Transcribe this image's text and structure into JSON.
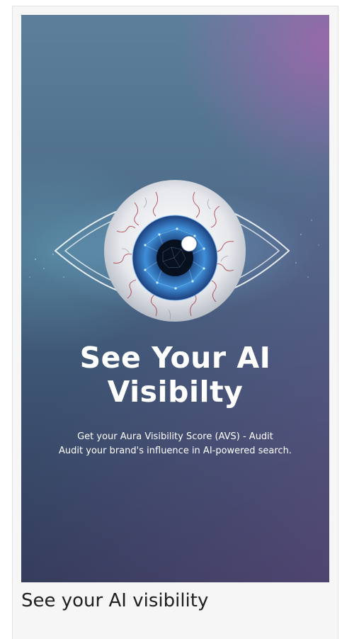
{
  "poster": {
    "headline_line1": "See Your AI",
    "headline_line2": "Visibilty",
    "subtitle_line1": "Get your Aura Visibility Score (AVS) - Audit",
    "subtitle_line2": "Audit your brand's influence in AI-powered search."
  },
  "caption": "See your AI visibility",
  "colors": {
    "background_top": "#5d7f9c",
    "background_bottom": "#2f3a57",
    "accent_purple": "#9b69aa",
    "iris_blue": "#3f8fd8",
    "text": "#ffffff"
  },
  "icons": {
    "hero": "eye-icon"
  }
}
